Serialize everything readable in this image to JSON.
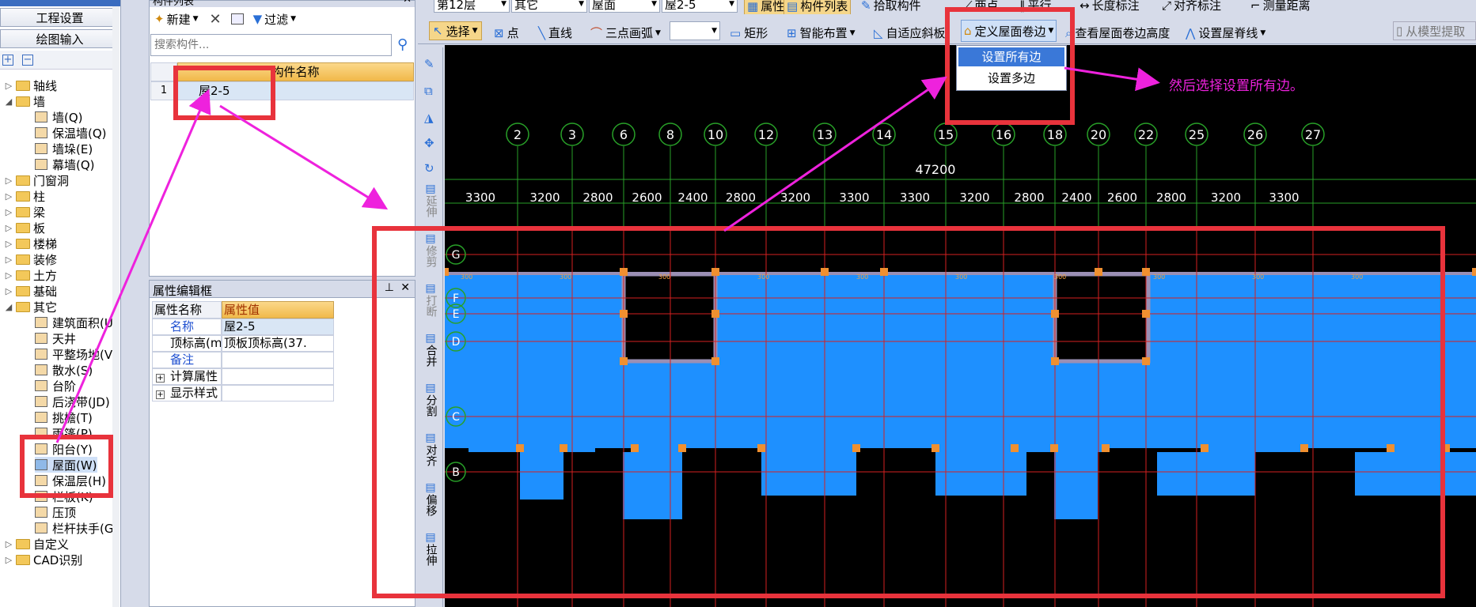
{
  "left_nav": {
    "title_stub": "...",
    "eng_settings": "工程设置",
    "draw_input": "绘图输入"
  },
  "tree": [
    {
      "label": "轴线",
      "level": 0,
      "exp": "▷"
    },
    {
      "label": "墙",
      "level": 0,
      "exp": "◢"
    },
    {
      "label": "墙(Q)",
      "level": 1,
      "icon": "wall-icon"
    },
    {
      "label": "保温墙(Q)",
      "level": 1,
      "icon": "insulated-wall-icon"
    },
    {
      "label": "墙垛(E)",
      "level": 1,
      "icon": "wall-pier-icon"
    },
    {
      "label": "幕墙(Q)",
      "level": 1,
      "icon": "curtain-wall-icon"
    },
    {
      "label": "门窗洞",
      "level": 0,
      "exp": "▷"
    },
    {
      "label": "柱",
      "level": 0,
      "exp": "▷"
    },
    {
      "label": "梁",
      "level": 0,
      "exp": "▷"
    },
    {
      "label": "板",
      "level": 0,
      "exp": "▷"
    },
    {
      "label": "楼梯",
      "level": 0,
      "exp": "▷"
    },
    {
      "label": "装修",
      "level": 0,
      "exp": "▷"
    },
    {
      "label": "土方",
      "level": 0,
      "exp": "▷"
    },
    {
      "label": "基础",
      "level": 0,
      "exp": "▷"
    },
    {
      "label": "其它",
      "level": 0,
      "exp": "◢"
    },
    {
      "label": "建筑面积(U)",
      "level": 1,
      "icon": "building-area-icon"
    },
    {
      "label": "天井",
      "level": 1,
      "icon": "patio-icon"
    },
    {
      "label": "平整场地(V)",
      "level": 1,
      "icon": "site-leveling-icon"
    },
    {
      "label": "散水(S)",
      "level": 1,
      "icon": "apron-icon"
    },
    {
      "label": "台阶",
      "level": 1,
      "icon": "steps-icon"
    },
    {
      "label": "后浇带(JD)",
      "level": 1,
      "icon": "post-pour-strip-icon"
    },
    {
      "label": "挑檐(T)",
      "level": 1,
      "icon": "eave-icon"
    },
    {
      "label": "雨篷(P)",
      "level": 1,
      "icon": "canopy-icon"
    },
    {
      "label": "阳台(Y)",
      "level": 1,
      "icon": "balcony-icon"
    },
    {
      "label": "屋面(W)",
      "level": 1,
      "icon": "roof-icon"
    },
    {
      "label": "保温层(H)",
      "level": 1,
      "icon": "insulation-layer-icon"
    },
    {
      "label": "栏板(K)",
      "level": 1,
      "icon": "parapet-icon"
    },
    {
      "label": "压顶",
      "level": 1,
      "icon": "coping-icon"
    },
    {
      "label": "栏杆扶手(G)",
      "level": 1,
      "icon": "railing-icon"
    },
    {
      "label": "自定义",
      "level": 0,
      "exp": "▷"
    },
    {
      "label": "CAD识别",
      "level": 0,
      "exp": "▷"
    }
  ],
  "component_list": {
    "title": "构件列表",
    "new_label": "新建",
    "filter_label": "过滤",
    "search_placeholder": "搜索构件...",
    "col_header": "构件名称",
    "rows": [
      {
        "num": "1",
        "name": "屋2-5"
      }
    ]
  },
  "property_editor": {
    "title": "属性编辑框",
    "col_name": "属性名称",
    "col_value": "属性值",
    "rows": [
      {
        "name": "名称",
        "value": "屋2-5",
        "blue": true
      },
      {
        "name": "顶标高(m)",
        "value": "顶板顶标高(37.",
        "blue": false
      },
      {
        "name": "备注",
        "value": "",
        "blue": true
      },
      {
        "name": "计算属性",
        "value": "",
        "blue": false,
        "expand": "+"
      },
      {
        "name": "显示样式",
        "value": "",
        "blue": false,
        "expand": "+"
      }
    ]
  },
  "toolbar1": {
    "floor": "第12层",
    "cat": "其它",
    "sub": "屋面",
    "comp": "屋2-5",
    "attr": "属性",
    "comp_list": "构件列表",
    "pick": "拾取构件",
    "grid": "两点",
    "parallel": "平行",
    "len_mark": "长度标注",
    "align_mark": "对齐标注",
    "measure": "测量距离"
  },
  "toolbar2": {
    "select": "选择",
    "point": "点",
    "line": "直线",
    "arc": "三点画弧",
    "rect": "矩形",
    "smart": "智能布置",
    "adapt": "自适应斜板",
    "define_edge": "定义屋面卷边",
    "view_edge": "查看屋面卷边高度",
    "set_ridge": "设置屋脊线",
    "extract": "从模型提取"
  },
  "dropdown": {
    "items": [
      "设置所有边",
      "设置多边"
    ]
  },
  "annotation": "然后选择设置所有边。",
  "vtools": [
    {
      "label": "延伸",
      "icon": "extend-icon"
    },
    {
      "label": "修剪",
      "icon": "trim-icon"
    },
    {
      "label": "打断",
      "icon": "break-icon"
    },
    {
      "label": "合并",
      "icon": "merge-icon"
    },
    {
      "label": "分割",
      "icon": "split-icon"
    },
    {
      "label": "对齐",
      "icon": "align-icon"
    },
    {
      "label": "偏移",
      "icon": "offset-icon"
    },
    {
      "label": "拉伸",
      "icon": "stretch-icon"
    }
  ],
  "cad": {
    "axes_top": [
      "2",
      "3",
      "6",
      "8",
      "10",
      "12",
      "13",
      "14",
      "15",
      "16",
      "18",
      "20",
      "22",
      "25",
      "26",
      "27"
    ],
    "axes_left": [
      "G",
      "F",
      "E",
      "D",
      "C",
      "B"
    ],
    "total_dim": "47200",
    "dims": [
      "3300",
      "3200",
      "2800",
      "2600",
      "2400",
      "2800",
      "3200",
      "3300",
      "3300",
      "3200",
      "2800",
      "2400",
      "2600",
      "2800",
      "3200",
      "3300"
    ],
    "marks": [
      "300",
      "300",
      "300",
      "300",
      "300",
      "300",
      "300",
      "300",
      "300",
      "300"
    ]
  },
  "colors": {
    "highlight": "#e8333c",
    "arrow": "#ee22dd",
    "roof": "#1e90ff",
    "wall": "#9a8fb4",
    "grid": "#d42020",
    "axis": "#28a028"
  }
}
